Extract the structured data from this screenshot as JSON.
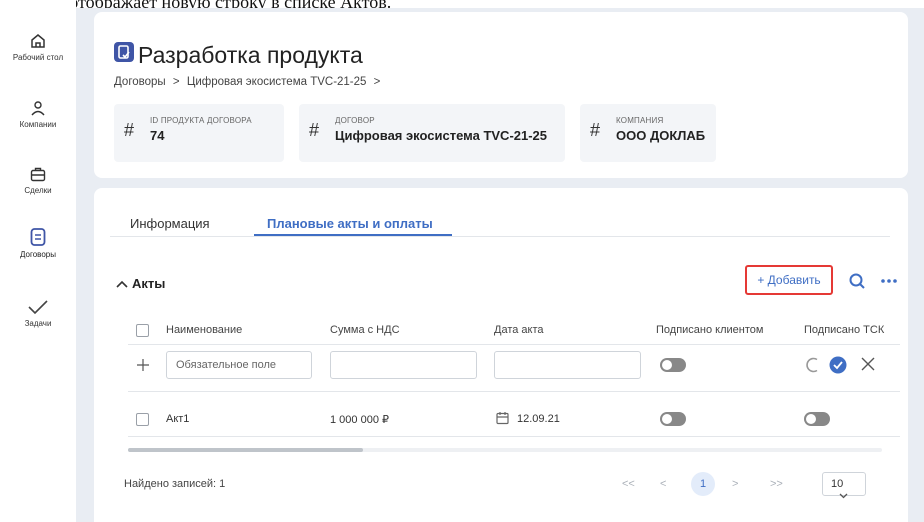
{
  "caption": "Система отображает новую строку в списке Актов.",
  "sidebar": {
    "items": [
      {
        "label": "Рабочий стол",
        "icon": "home-icon"
      },
      {
        "label": "Компании",
        "icon": "users-icon"
      },
      {
        "label": "Сделки",
        "icon": "briefcase-icon"
      },
      {
        "label": "Договоры",
        "icon": "document-icon"
      },
      {
        "label": "Задачи",
        "icon": "checkmark-icon"
      }
    ]
  },
  "header": {
    "title": "Разработка продукта",
    "breadcrumb": [
      "Договоры",
      "Цифровая экосистема TVC-21-25"
    ],
    "breadcrumb_sep": ">",
    "info": [
      {
        "label": "ID ПРОДУКТА ДОГОВОРА",
        "value": "74"
      },
      {
        "label": "ДОГОВОР",
        "value": "Цифровая экосистема TVC-21-25"
      },
      {
        "label": "КОМПАНИЯ",
        "value": "ООО ДОКЛАБ"
      }
    ]
  },
  "tabs": [
    {
      "label": "Информация",
      "active": false
    },
    {
      "label": "Плановые акты и оплаты",
      "active": true
    }
  ],
  "section": {
    "title": "Акты",
    "add_label": "+ Добавить"
  },
  "table": {
    "columns": [
      "Наименование",
      "Сумма с НДС",
      "Дата акта",
      "Подписано клиентом",
      "Подписано ТСК"
    ],
    "new_row": {
      "name_placeholder": "Обязательное поле"
    },
    "rows": [
      {
        "name": "Акт1",
        "amount": "1 000 000 ₽",
        "date": "12.09.21",
        "signed_client": false,
        "signed_tsk": false
      }
    ]
  },
  "footer": {
    "found": "Найдено записей: 1",
    "pagination": {
      "first": "<<",
      "prev": "<",
      "current": "1",
      "next": ">",
      "last": ">>"
    },
    "page_size": "10"
  },
  "colors": {
    "accent": "#3f6ec4",
    "highlight": "#e53935",
    "brand": "#3f55a6"
  }
}
